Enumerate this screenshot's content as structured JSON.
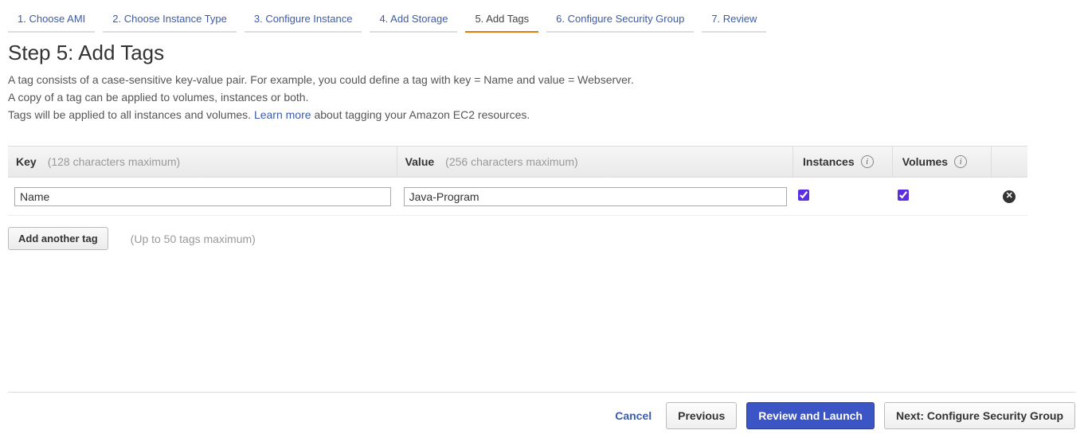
{
  "wizard": {
    "steps": [
      {
        "label": "1. Choose AMI"
      },
      {
        "label": "2. Choose Instance Type"
      },
      {
        "label": "3. Configure Instance"
      },
      {
        "label": "4. Add Storage"
      },
      {
        "label": "5. Add Tags"
      },
      {
        "label": "6. Configure Security Group"
      },
      {
        "label": "7. Review"
      }
    ]
  },
  "page": {
    "title": "Step 5: Add Tags",
    "desc1": "A tag consists of a case-sensitive key-value pair. For example, you could define a tag with key = Name and value = Webserver.",
    "desc2": "A copy of a tag can be applied to volumes, instances or both.",
    "desc3_pre": "Tags will be applied to all instances and volumes. ",
    "desc3_link": "Learn more",
    "desc3_post": " about tagging your Amazon EC2 resources."
  },
  "table": {
    "headers": {
      "key": "Key",
      "key_hint": "(128 characters maximum)",
      "value": "Value",
      "value_hint": "(256 characters maximum)",
      "instances": "Instances",
      "volumes": "Volumes"
    },
    "row": {
      "key": "Name",
      "value": "Java-Program",
      "instances_checked": true,
      "volumes_checked": true
    }
  },
  "add": {
    "button": "Add another tag",
    "hint": "(Up to 50 tags maximum)"
  },
  "footer": {
    "cancel": "Cancel",
    "previous": "Previous",
    "review": "Review and Launch",
    "next": "Next: Configure Security Group"
  }
}
